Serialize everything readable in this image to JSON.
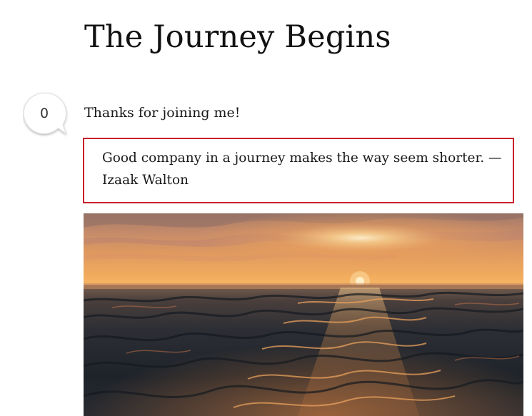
{
  "post": {
    "title": "The Journey Begins",
    "comment_count": "0",
    "intro": "Thanks for joining me!",
    "quote": "Good company in a journey makes the way seem shorter. — Izaak Walton"
  },
  "image": {
    "subject": "sunset-over-ocean",
    "colors": {
      "sky_top": "#a87a6c",
      "sky_glow": "#f4a35c",
      "sun": "#fff4d8",
      "sea_dark": "#1f242c",
      "sea_highlight": "#e69650"
    }
  }
}
